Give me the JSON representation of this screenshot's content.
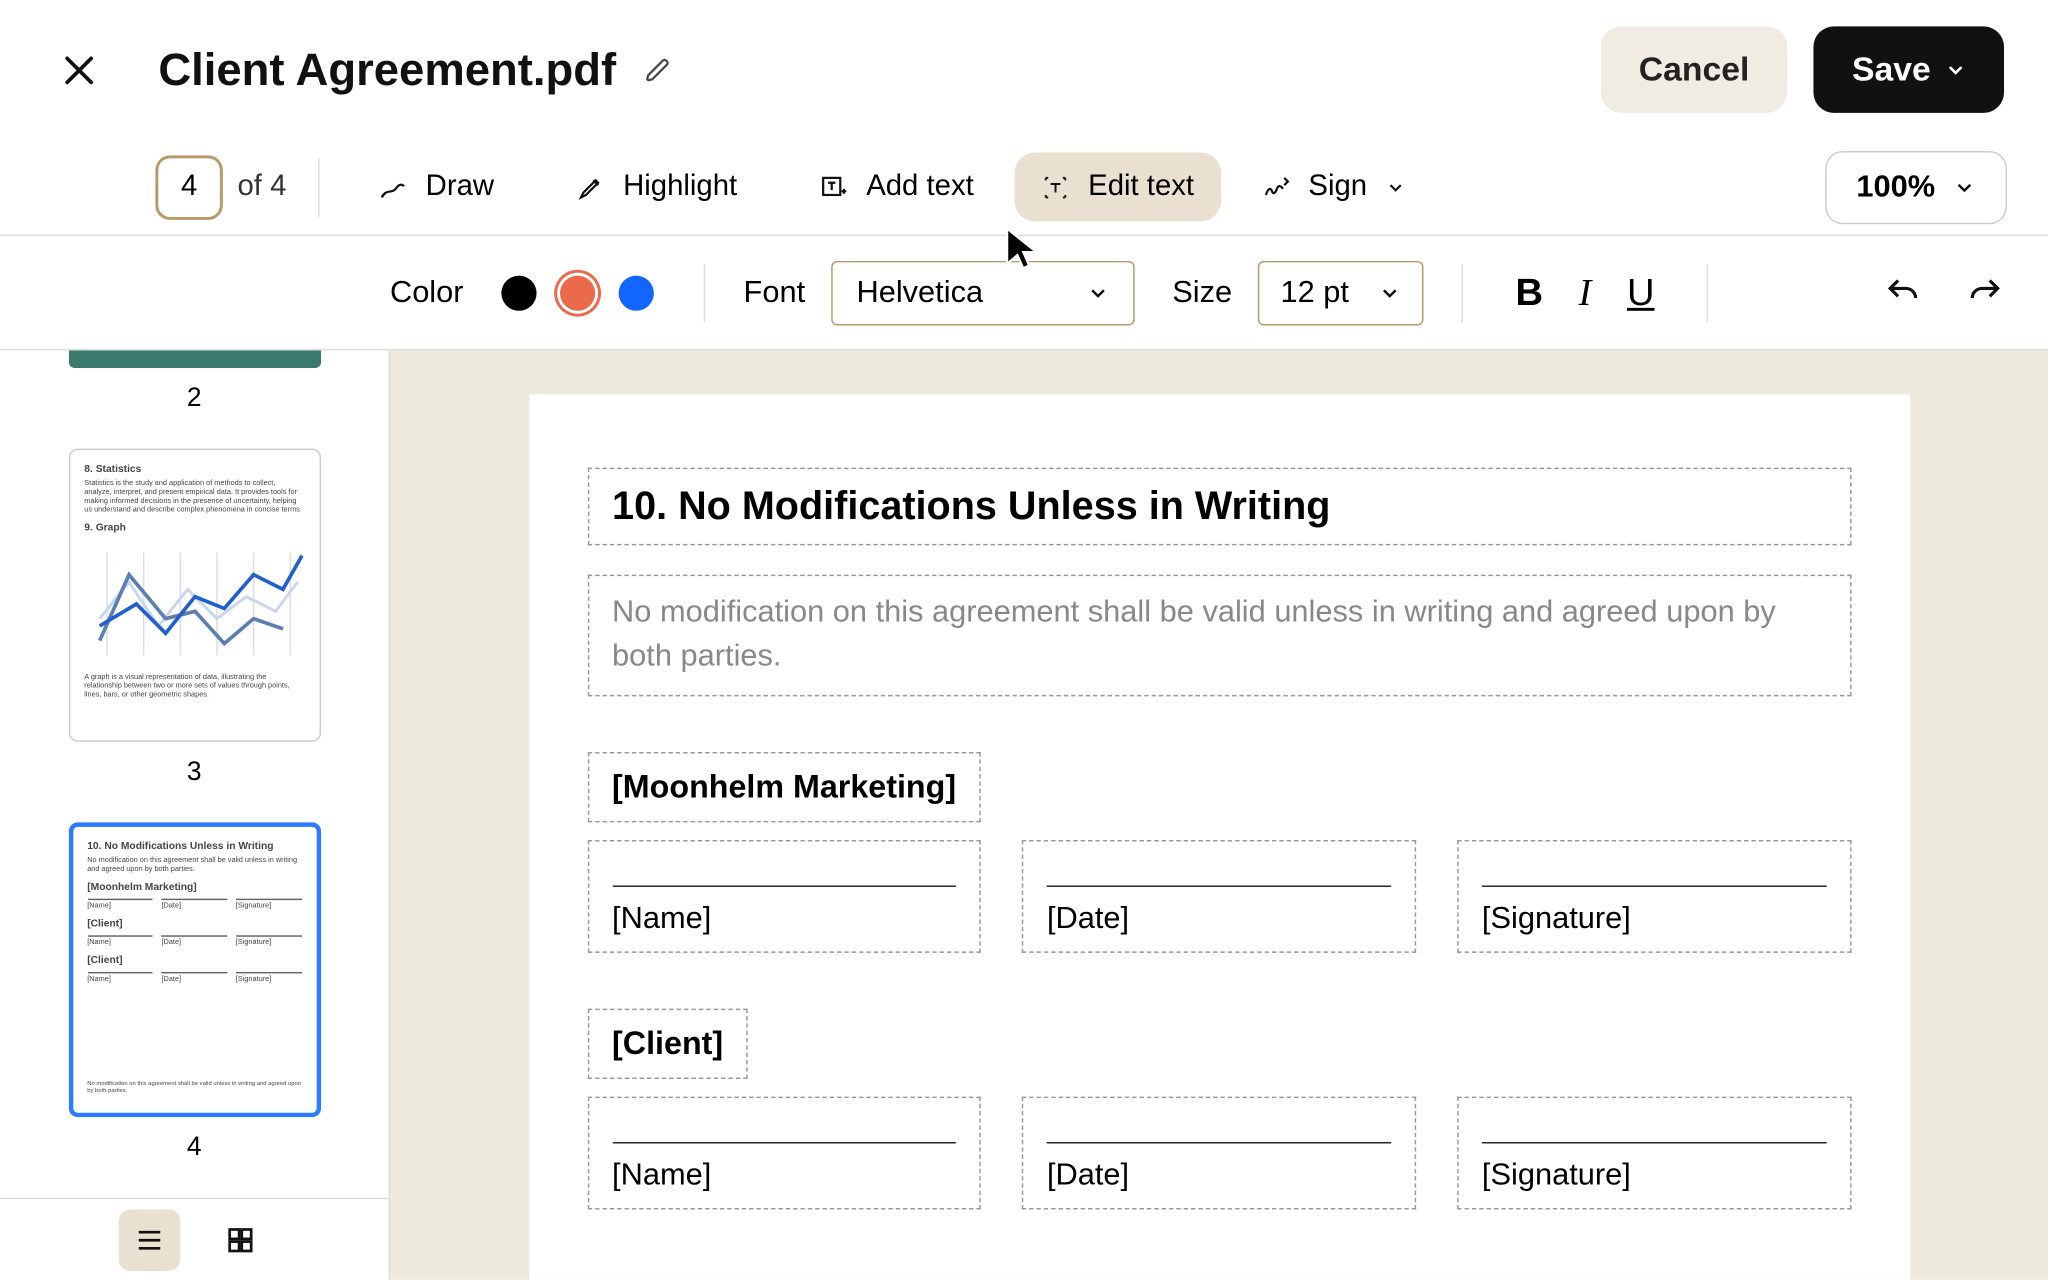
{
  "header": {
    "title": "Client Agreement.pdf",
    "cancel": "Cancel",
    "save": "Save"
  },
  "toolbar": {
    "page_current": "4",
    "page_of": "of 4",
    "draw": "Draw",
    "highlight": "Highlight",
    "add_text": "Add text",
    "edit_text": "Edit text",
    "sign": "Sign",
    "zoom": "100%"
  },
  "fmt": {
    "color_label": "Color",
    "font_label": "Font",
    "font_value": "Helvetica",
    "size_label": "Size",
    "size_value": "12 pt",
    "colors": {
      "black": "#000000",
      "orange": "#ea6a4b",
      "blue": "#1365ff"
    },
    "selected_color": "orange"
  },
  "thumbs": {
    "p2_num": "2",
    "p3_num": "3",
    "p4_num": "4",
    "p3": {
      "h1": "8. Statistics",
      "body1": "Statistics is the study and application of methods to collect, analyze, interpret, and present empirical data. It provides tools for making informed decisions in the presence of uncertainty, helping us understand and describe complex phenomena in concise terms.",
      "h2": "9. Graph",
      "body2": "A graph is a visual representation of data, illustrating the relationship between two or more sets of values through points, lines, bars, or other geometric shapes."
    },
    "p4": {
      "h1": "10. No Modifications Unless in Writing",
      "body": "No modification on this agreement shall be valid unless in writing and agreed upon by both parties.",
      "party1": "[Moonhelm Marketing]",
      "party2": "[Client]",
      "name": "[Name]",
      "date": "[Date]",
      "sig": "[Signature]",
      "footer": "No modification on this agreement shall be valid unless in writing and agreed upon by both parties."
    }
  },
  "page": {
    "heading": "10. No Modifications Unless in Writing",
    "body": "No modification on this agreement shall be valid unless in writing and agreed upon by both parties.",
    "party1": "[Moonhelm Marketing]",
    "party2": "[Client]",
    "name": "[Name]",
    "date": "[Date]",
    "signature": "[Signature]"
  }
}
